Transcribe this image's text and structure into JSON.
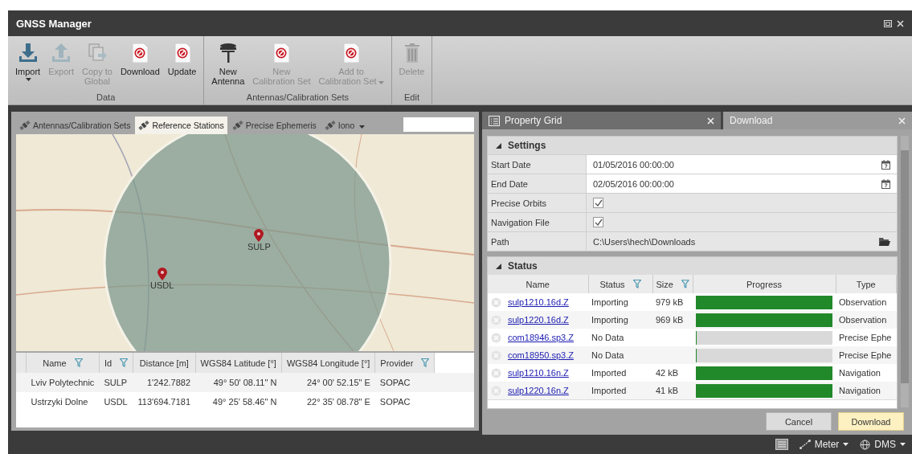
{
  "window": {
    "title": "GNSS Manager"
  },
  "ribbon": {
    "groups": [
      {
        "label": "Data",
        "buttons": [
          {
            "label": "Import",
            "kind": "import",
            "disabled": false,
            "dropdown": true
          },
          {
            "label": "Export",
            "kind": "export",
            "disabled": true,
            "dropdown": false
          },
          {
            "label": "Copy to\nGlobal",
            "kind": "copy",
            "disabled": true,
            "dropdown": false
          },
          {
            "label": "Download",
            "kind": "blocked",
            "disabled": false,
            "dropdown": false
          },
          {
            "label": "Update",
            "kind": "blocked",
            "disabled": false,
            "dropdown": false
          }
        ]
      },
      {
        "label": "Antennas/Calibration Sets",
        "buttons": [
          {
            "label": "New\nAntenna",
            "kind": "antenna",
            "disabled": false,
            "dropdown": false
          },
          {
            "label": "New\nCalibration Set",
            "kind": "blocked",
            "disabled": true,
            "dropdown": false
          },
          {
            "label": "Add to\nCalibration Set",
            "kind": "blocked",
            "disabled": true,
            "dropdown": true
          }
        ]
      },
      {
        "label": "Edit",
        "buttons": [
          {
            "label": "Delete",
            "kind": "trash",
            "disabled": true,
            "dropdown": false
          }
        ]
      }
    ]
  },
  "tabs": [
    {
      "label": "Antennas/Calibration Sets",
      "selected": false
    },
    {
      "label": "Reference Stations",
      "selected": true
    },
    {
      "label": "Precise Ephemeris",
      "selected": false
    },
    {
      "label": "Iono",
      "selected": false
    }
  ],
  "map": {
    "markers": [
      {
        "label": "SULP"
      },
      {
        "label": "USDL"
      }
    ]
  },
  "stations": {
    "columns": [
      {
        "label": "Name",
        "filter": true
      },
      {
        "label": "Id",
        "filter": true
      },
      {
        "label": "Distance [m]",
        "filter": false
      },
      {
        "label": "WGS84 Latitude [°]",
        "filter": false
      },
      {
        "label": "WGS84 Longitude [°]",
        "filter": false
      },
      {
        "label": "Provider",
        "filter": true
      }
    ],
    "rows": [
      [
        "Lviv Polytechnic",
        "SULP",
        "1'242.7882",
        "49° 50' 08.11\" N",
        "24° 00' 52.15\" E",
        "SOPAC"
      ],
      [
        "Ustrzyki Dolne",
        "USDL",
        "113'694.7181",
        "49° 25' 58.46\" N",
        "22° 35' 08.78\" E",
        "SOPAC"
      ]
    ]
  },
  "panel_tabs": [
    {
      "label": "Property Grid",
      "selected": false
    },
    {
      "label": "Download",
      "selected": true
    }
  ],
  "settings": {
    "title": "Settings",
    "expanded": true,
    "rows": [
      {
        "kind": "date",
        "label": "Start Date",
        "value": "01/05/2016 00:00:00"
      },
      {
        "kind": "date",
        "label": "End Date",
        "value": "02/05/2016 00:00:00"
      },
      {
        "kind": "check",
        "label": "Precise Orbits",
        "checked": true
      },
      {
        "kind": "check",
        "label": "Navigation File",
        "checked": true
      },
      {
        "kind": "path",
        "label": "Path",
        "value": "C:\\Users\\hech\\Downloads"
      }
    ]
  },
  "status": {
    "title": "Status",
    "expanded": true,
    "columns": [
      {
        "label": "Name",
        "filter": false
      },
      {
        "label": "Status",
        "filter": true
      },
      {
        "label": "Size",
        "filter": true
      },
      {
        "label": "Progress",
        "filter": false
      },
      {
        "label": "Type",
        "filter": false
      }
    ],
    "rows": [
      {
        "name": "sulp1210.16d.Z",
        "status": "Importing",
        "size": "979 kB",
        "level": 1,
        "type": "Observation"
      },
      {
        "name": "sulp1220.16d.Z",
        "status": "Importing",
        "size": "969 kB",
        "level": 1,
        "type": "Observation"
      },
      {
        "name": "com18946.sp3.Z",
        "status": "No Data",
        "size": "",
        "level": 0,
        "type": "Precise Ephe"
      },
      {
        "name": "com18950.sp3.Z",
        "status": "No Data",
        "size": "",
        "level": 0,
        "type": "Precise Ephe"
      },
      {
        "name": "sulp1210.16n.Z",
        "status": "Imported",
        "size": "42 kB",
        "level": 1,
        "type": "Navigation"
      },
      {
        "name": "sulp1220.16n.Z",
        "status": "Imported",
        "size": "41 kB",
        "level": 1,
        "type": "Navigation"
      }
    ]
  },
  "buttons": [
    {
      "label": "Cancel",
      "highlighted": false
    },
    {
      "label": "Download",
      "highlighted": true
    }
  ],
  "status_bar": {
    "unit": "Meter",
    "format": "DMS"
  }
}
